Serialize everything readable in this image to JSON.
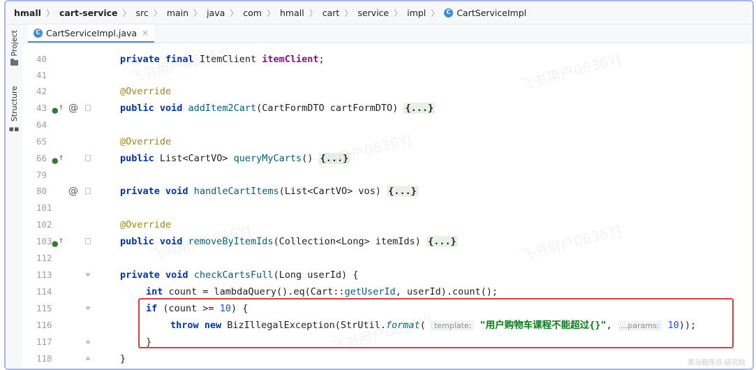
{
  "breadcrumb": {
    "items": [
      "hmall",
      "cart-service",
      "src",
      "main",
      "java",
      "com",
      "hmall",
      "cart",
      "service",
      "impl",
      "CartServiceImpl"
    ]
  },
  "sidebar": {
    "project_label": "Project",
    "structure_label": "Structure"
  },
  "tab": {
    "filename": "CartServiceImpl.java",
    "close": "×"
  },
  "code": {
    "line_numbers": [
      "40",
      "41",
      "42",
      "43",
      "64",
      "65",
      "66",
      "79",
      "80",
      "101",
      "102",
      "103",
      "112",
      "113",
      "114",
      "115",
      "116",
      "117",
      "118"
    ],
    "ann_override": "@Override",
    "l40": {
      "kw1": "private final",
      "type": "ItemClient",
      "field": "itemClient",
      "tail": ";"
    },
    "l43": {
      "kw": "public void",
      "name": "addItem2Cart",
      "params": "(CartFormDTO cartFormDTO)",
      "fold": "{...}"
    },
    "l66": {
      "kw": "public",
      "pre": "List<CartVO>",
      "name": "queryMyCarts",
      "params": "()",
      "fold": "{...}"
    },
    "l80": {
      "kw": "private void",
      "name": "handleCartItems",
      "params": "(List<CartVO> vos)",
      "fold": "{...}"
    },
    "l103": {
      "kw": "public void",
      "name": "removeByItemIds",
      "params": "(Collection<Long> itemIds)",
      "fold": "{...}"
    },
    "l113": {
      "kw": "private void",
      "name": "checkCartsFull",
      "params": "(Long userId) {"
    },
    "l114": {
      "kw": "int",
      "rest1": "count = lambdaQuery().eq(Cart::",
      "method": "getUserId",
      "rest2": ", userId).count();"
    },
    "l115": {
      "kw": "if",
      "rest1": "(count >= ",
      "num": "10",
      "rest2": ") {"
    },
    "l116": {
      "kw": "throw new",
      "cls": "BizIllegalException(StrUtil.",
      "method": "format",
      "paren": "(",
      "hint1": "template:",
      "str": "\"用户购物车课程不能超过{}\"",
      "comma": ",",
      "hint2": "...params:",
      "num": "10",
      "tail": "));"
    },
    "l117": "}",
    "l118": "}"
  },
  "watermarks": [
    "飞书用户0636YJ"
  ],
  "corner_text": "黑马程序员·研究院",
  "colors": {
    "highlight": "#d93e3e",
    "frame": "#a9b4ef"
  }
}
